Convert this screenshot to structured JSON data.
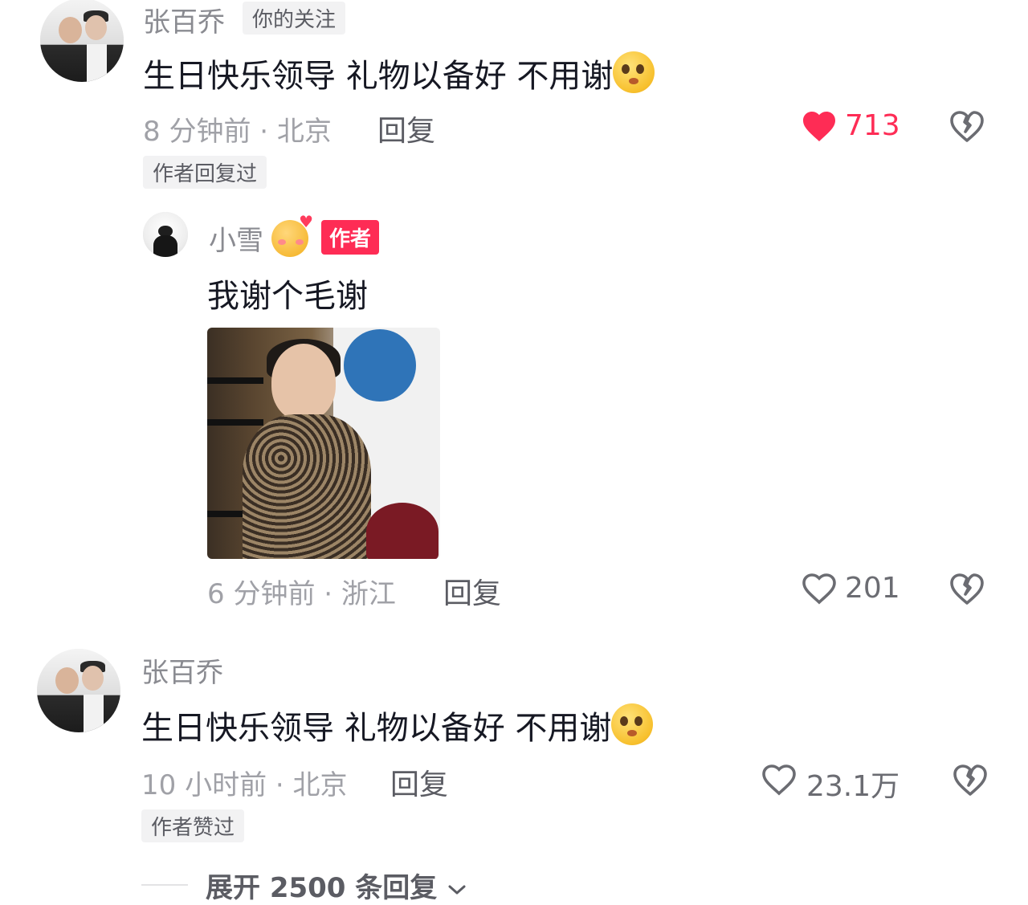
{
  "comments": [
    {
      "username": "张百乔",
      "follow_tag": "你的关注",
      "text": "生日快乐领导 礼物以备好 不用谢",
      "time_location": "8 分钟前 · 北京",
      "reply_label": "回复",
      "likes": "713",
      "liked": true,
      "author_tag": "作者回复过",
      "replies": [
        {
          "username": "小雪",
          "author_badge": "作者",
          "text": "我谢个毛谢",
          "time_location": "6 分钟前 · 浙江",
          "reply_label": "回复",
          "likes": "201"
        }
      ]
    },
    {
      "username": "张百乔",
      "text": "生日快乐领导 礼物以备好 不用谢",
      "time_location": "10 小时前 · 北京",
      "reply_label": "回复",
      "likes": "23.1万",
      "author_tag": "作者赞过",
      "expand_label": "展开 2500 条回复"
    }
  ],
  "colors": {
    "like_red": "#fe2c55",
    "text_primary": "#161823",
    "text_secondary": "#a0a1a7"
  },
  "icons": [
    "heart-filled-icon",
    "heart-outline-icon",
    "broken-heart-icon",
    "chevron-down-icon"
  ]
}
